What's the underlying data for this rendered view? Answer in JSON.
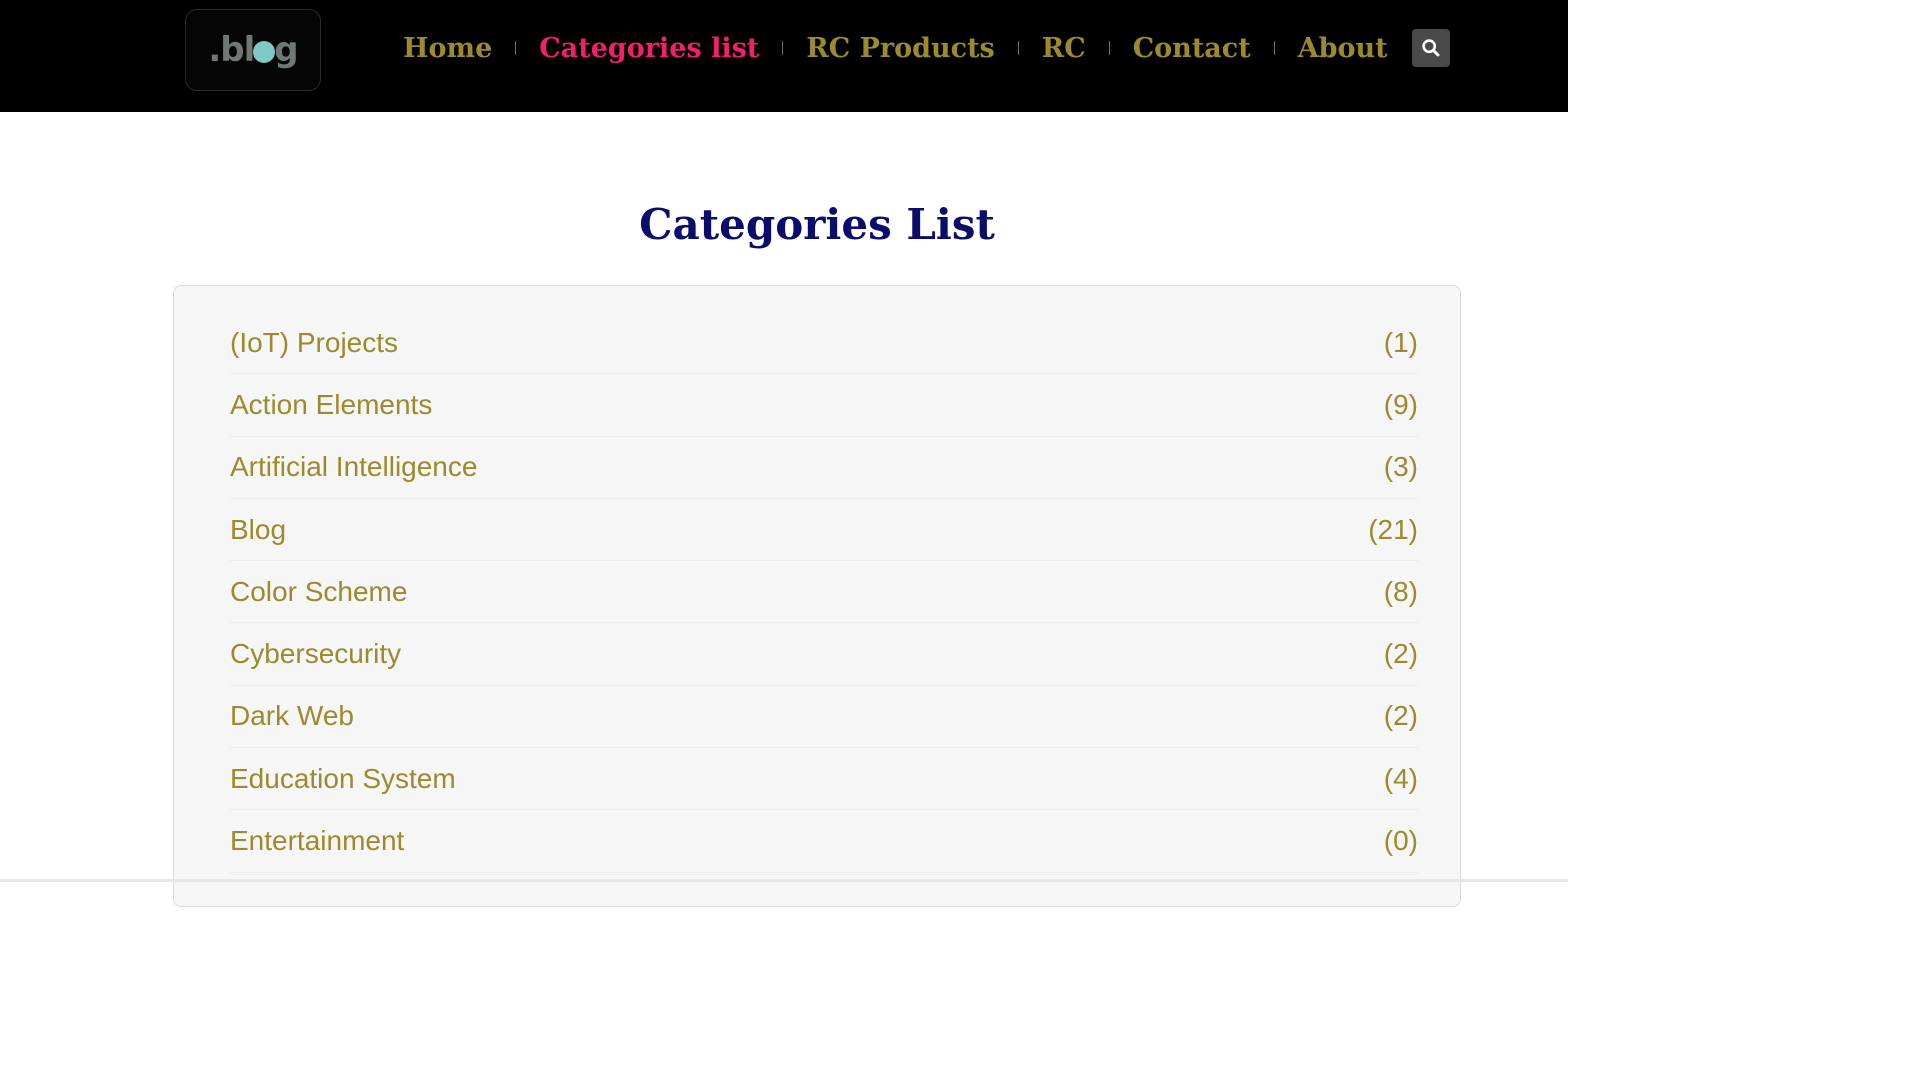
{
  "header": {
    "logo_text_left": ".bl",
    "logo_text_right": "g",
    "nav": [
      {
        "label": "Home",
        "active": false
      },
      {
        "label": "Categories list",
        "active": true
      },
      {
        "label": "RC Products",
        "active": false
      },
      {
        "label": "RC",
        "active": false
      },
      {
        "label": "Contact",
        "active": false
      },
      {
        "label": "About",
        "active": false
      }
    ],
    "search_icon": "search-icon"
  },
  "main": {
    "title": "Categories List",
    "categories": [
      {
        "name": "(IoT) Projects",
        "count": "(1)"
      },
      {
        "name": "Action Elements",
        "count": "(9)"
      },
      {
        "name": "Artificial Intelligence",
        "count": "(3)"
      },
      {
        "name": "Blog",
        "count": "(21)"
      },
      {
        "name": "Color Scheme",
        "count": "(8)"
      },
      {
        "name": "Cybersecurity",
        "count": "(2)"
      },
      {
        "name": "Dark Web",
        "count": "(2)"
      },
      {
        "name": "Education System",
        "count": "(4)"
      },
      {
        "name": "Entertainment",
        "count": "(0)"
      }
    ]
  },
  "colors": {
    "nav_text": "#9b8a2e",
    "nav_active": "#f2206c",
    "title": "#0b0d6a",
    "header_bg": "#000000"
  }
}
